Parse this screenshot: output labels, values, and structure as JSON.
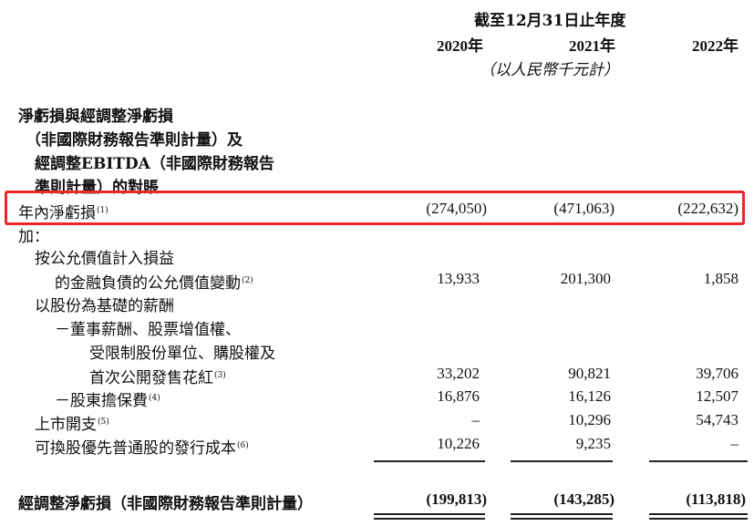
{
  "header": {
    "period_title": "截至12月31日止年度",
    "years": [
      "2020年",
      "2021年",
      "2022年"
    ],
    "unit": "（以人民幣千元計）"
  },
  "section_title": {
    "line1": "淨虧損與經調整淨虧損",
    "line2": "（非國際財務報告準則計量）及",
    "line3": "經調整EBITDA（非國際財務報告",
    "line4": "準則計量）的對賬"
  },
  "rows": {
    "net_loss": {
      "label": "年內淨虧損",
      "note": "(1)",
      "values": [
        "(274,050)",
        "(471,063)",
        "(222,632)"
      ]
    },
    "add": {
      "label": "加："
    },
    "fv_line1": {
      "label": "按公允價值計入損益"
    },
    "fv_line2": {
      "label": "的金融負債的公允價值變動",
      "note": "(2)",
      "values": [
        "13,933",
        "201,300",
        "1,858"
      ]
    },
    "sbc": {
      "label": "以股份為基礎的薪酬"
    },
    "sbc_a1": {
      "label": "－董事薪酬、股票增值權、"
    },
    "sbc_a2": {
      "label": "受限制股份單位、購股權及"
    },
    "sbc_a3": {
      "label": "首次公開發售花紅",
      "note": "(3)",
      "values": [
        "33,202",
        "90,821",
        "39,706"
      ]
    },
    "sbc_b": {
      "label": "－股東擔保費",
      "note": "(4)",
      "values": [
        "16,876",
        "16,126",
        "12,507"
      ]
    },
    "listing": {
      "label": "上市開支",
      "note": "(5)",
      "values": [
        "–",
        "10,296",
        "54,743"
      ]
    },
    "issuance": {
      "label": "可換股優先普通股的發行成本",
      "note": "(6)",
      "values": [
        "10,226",
        "9,235",
        "–"
      ]
    },
    "adjusted": {
      "label": "經調整淨虧損（非國際財務報告準則計量）",
      "values": [
        "(199,813)",
        "(143,285)",
        "(113,818)"
      ]
    }
  },
  "colors": {
    "highlight": "#e8282b"
  }
}
